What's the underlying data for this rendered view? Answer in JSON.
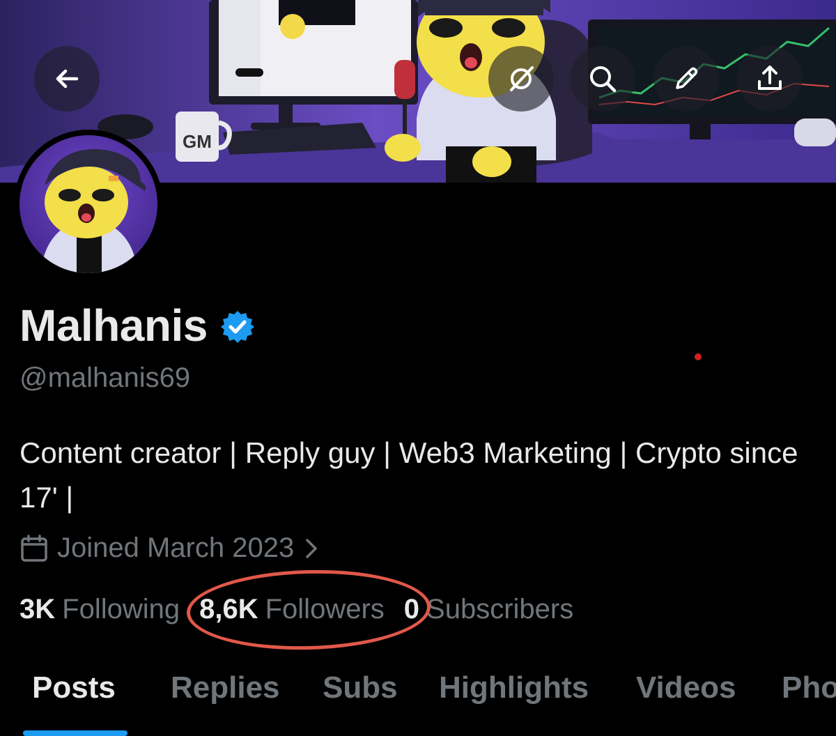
{
  "header": {
    "back_button": "arrow-left-icon",
    "actions": [
      "grok-icon",
      "search-icon",
      "pencil-icon",
      "share-icon"
    ]
  },
  "profile": {
    "display_name": "Malhanis",
    "verified": true,
    "handle": "@malhanis69",
    "bio": "Content creator | Reply guy | Web3 Marketing | Crypto since 17' |",
    "joined": "Joined March 2023",
    "stats": [
      {
        "value": "3K",
        "label": "Following"
      },
      {
        "value": "8,6K",
        "label": "Followers"
      },
      {
        "value": "0",
        "label": "Subscribers"
      }
    ]
  },
  "tabs": [
    {
      "label": "Posts",
      "active": true
    },
    {
      "label": "Replies",
      "active": false
    },
    {
      "label": "Subs",
      "active": false
    },
    {
      "label": "Highlights",
      "active": false
    },
    {
      "label": "Videos",
      "active": false
    },
    {
      "label": "Pho",
      "active": false
    }
  ],
  "banner": {
    "mug_text": "GM"
  },
  "colors": {
    "background": "#000000",
    "primary_text": "#e7e9ea",
    "secondary_text": "#71767b",
    "accent": "#1d9bf0",
    "annotation_circle": "#e0584a"
  }
}
